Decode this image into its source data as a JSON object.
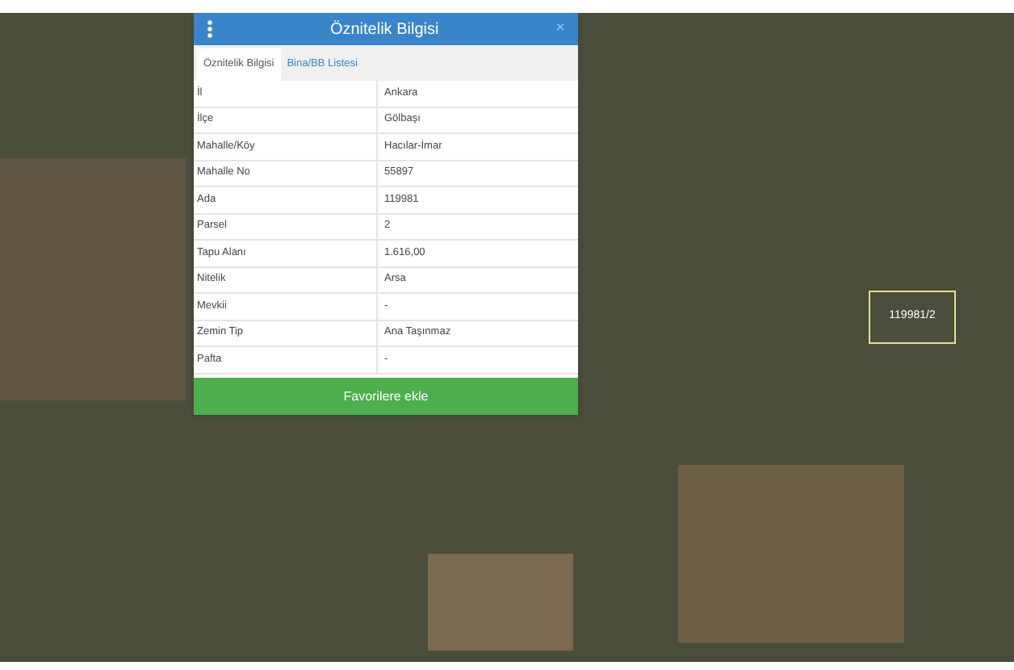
{
  "panel": {
    "title": "Öznitelik Bilgisi",
    "close": "×",
    "tabs": [
      {
        "label": "Öznitelik Bilgisi",
        "selected": true
      },
      {
        "label": "Bina/BB Listesi",
        "selected": false
      }
    ],
    "rows": [
      {
        "label": "İl",
        "value": "Ankara"
      },
      {
        "label": "İlçe",
        "value": "Gölbaşı"
      },
      {
        "label": "Mahalle/Köy",
        "value": "Hacılar-İmar"
      },
      {
        "label": "Mahalle No",
        "value": "55897"
      },
      {
        "label": "Ada",
        "value": "119981"
      },
      {
        "label": "Parsel",
        "value": "2"
      },
      {
        "label": "Tapu Alanı",
        "value": "1.616,00"
      },
      {
        "label": "Nitelik",
        "value": "Arsa"
      },
      {
        "label": "Mevkii",
        "value": "-"
      },
      {
        "label": "Zemin Tip",
        "value": "Ana Taşınmaz"
      },
      {
        "label": "Pafta",
        "value": "-"
      }
    ],
    "button": "Favorilere ekle"
  },
  "map": {
    "parcel_label": "119981/2"
  }
}
